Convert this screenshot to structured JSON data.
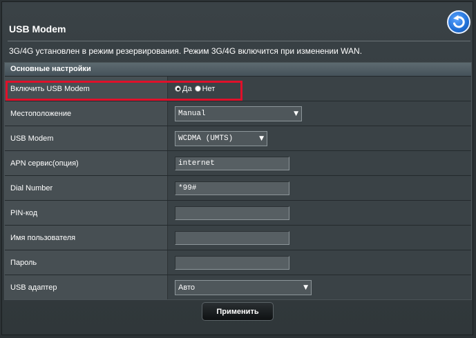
{
  "header": {
    "title": "USB Modem",
    "description": "3G/4G установлен в режим резервирования. Режим 3G/4G включится при изменении WAN."
  },
  "section": {
    "title": "Основные настройки"
  },
  "fields": {
    "enable": {
      "label": "Включить USB Modem",
      "options": [
        "Да",
        "Нет"
      ],
      "selected": "Да"
    },
    "location": {
      "label": "Местоположение",
      "value": "Manual"
    },
    "usb_modem": {
      "label": "USB Modem",
      "value": "WCDMA (UMTS)"
    },
    "apn": {
      "label": "APN сервис(опция)",
      "value": "internet"
    },
    "dial": {
      "label": "Dial Number",
      "value": "*99#"
    },
    "pin": {
      "label": "PIN-код",
      "value": ""
    },
    "username": {
      "label": "Имя пользователя",
      "value": ""
    },
    "password": {
      "label": "Пароль",
      "value": ""
    },
    "adapter": {
      "label": "USB адаптер",
      "value": "Авто"
    }
  },
  "actions": {
    "apply_label": "Применить"
  },
  "icons": {
    "back": "back-arrow-icon",
    "dropdown": "chevron-down-icon"
  },
  "colors": {
    "highlight": "#e0102a",
    "back_button": "#1f6fd6"
  }
}
